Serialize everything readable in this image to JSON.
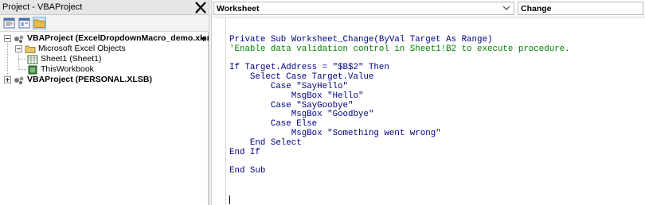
{
  "project_pane": {
    "title": "Project - VBAProject",
    "toolbar": [
      "view-code-icon",
      "view-object-icon",
      "toggle-folders-icon"
    ],
    "tree": [
      {
        "label": "VBAProject (ExcelDropdownMacro_demo.xlsm)",
        "icon": "vba-project-icon",
        "expanded": true
      },
      {
        "label": "Microsoft Excel Objects",
        "icon": "folder-icon",
        "expanded": true
      },
      {
        "label": "Sheet1 (Sheet1)",
        "icon": "worksheet-icon"
      },
      {
        "label": "ThisWorkbook",
        "icon": "workbook-icon"
      },
      {
        "label": "VBAProject (PERSONAL.XLSB)",
        "icon": "vba-project-icon",
        "expanded": false
      }
    ]
  },
  "code_pane": {
    "object_combo": "Worksheet",
    "procedure_combo": "Change",
    "lines": [
      [
        {
          "t": "Private Sub Worksheet_Change(ByVal Target As Range)",
          "c": "kw"
        }
      ],
      [
        {
          "t": "'Enable data validation control in Sheet1!B2 to execute procedure.",
          "c": "cm"
        }
      ],
      [
        {
          "t": "",
          "c": "pl"
        }
      ],
      [
        {
          "t": "If Target.Address = \"$B$2\" Then",
          "c": "kw"
        }
      ],
      [
        {
          "t": "    Select Case Target.Value",
          "c": "kw"
        }
      ],
      [
        {
          "t": "        Case \"SayHello\"",
          "c": "kw"
        }
      ],
      [
        {
          "t": "            MsgBox \"Hello\"",
          "c": "kw"
        }
      ],
      [
        {
          "t": "        Case \"SayGoobye\"",
          "c": "kw"
        }
      ],
      [
        {
          "t": "            MsgBox \"Goodbye\"",
          "c": "kw"
        }
      ],
      [
        {
          "t": "        Case Else",
          "c": "kw"
        }
      ],
      [
        {
          "t": "            MsgBox \"Something went wrong\"",
          "c": "kw"
        }
      ],
      [
        {
          "t": "    End Select",
          "c": "kw"
        }
      ],
      [
        {
          "t": "End If",
          "c": "kw"
        }
      ],
      [
        {
          "t": "",
          "c": "pl"
        }
      ],
      [
        {
          "t": "End Sub",
          "c": "kw"
        }
      ]
    ]
  },
  "colors": {
    "keyword": "#00007f",
    "comment": "#008000",
    "toolbar_active": "#cfe3f7"
  }
}
